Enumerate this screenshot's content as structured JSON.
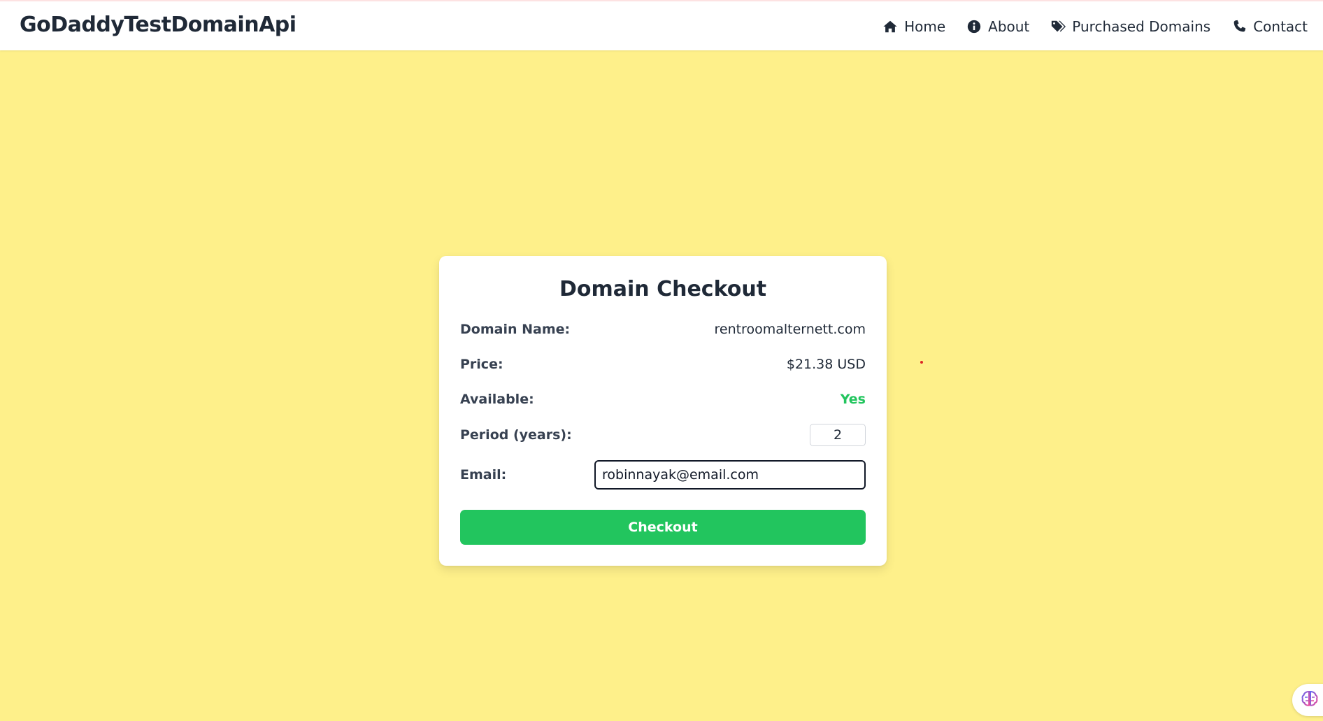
{
  "navbar": {
    "brand": "GoDaddyTestDomainApi",
    "items": [
      {
        "label": "Home",
        "icon": "home-icon"
      },
      {
        "label": "About",
        "icon": "info-icon"
      },
      {
        "label": "Purchased Domains",
        "icon": "tags-icon"
      },
      {
        "label": "Contact",
        "icon": "phone-icon"
      }
    ]
  },
  "checkout": {
    "title": "Domain Checkout",
    "domain_label": "Domain Name:",
    "domain_value": "rentroomalternett.com",
    "price_label": "Price:",
    "price_value": "$21.38 USD",
    "available_label": "Available:",
    "available_value": "Yes",
    "period_label": "Period (years):",
    "period_value": "2",
    "email_label": "Email:",
    "email_value": "robinnayak@email.com",
    "button_label": "Checkout"
  },
  "colors": {
    "page_background": "#fef08a",
    "accent_green": "#22c55e",
    "text_dark": "#1f2937"
  },
  "floating_widget": {
    "icon": "brain-icon"
  }
}
